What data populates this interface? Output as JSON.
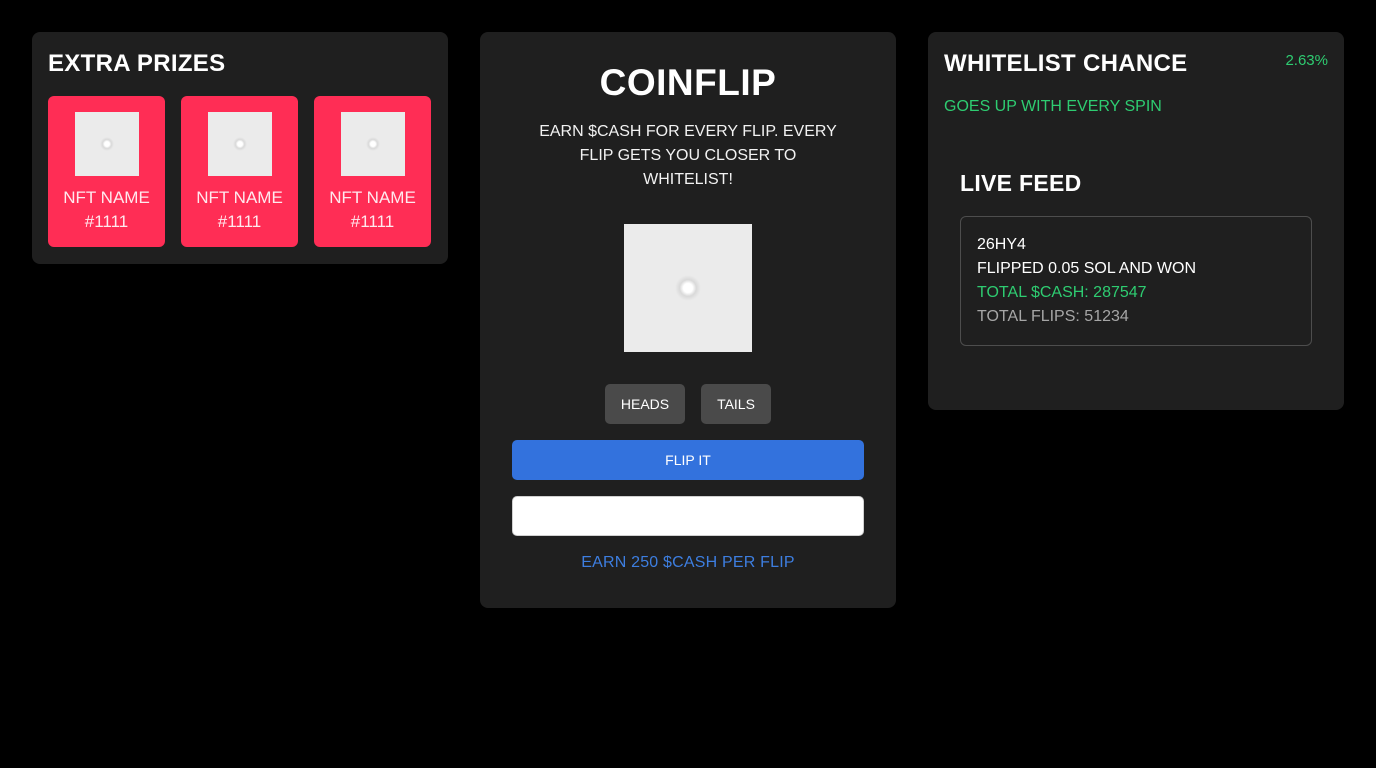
{
  "extra_prizes": {
    "title": "EXTRA PRIZES",
    "items": [
      {
        "name": "NFT NAME #1111"
      },
      {
        "name": "NFT NAME #1111"
      },
      {
        "name": "NFT NAME #1111"
      }
    ]
  },
  "coinflip": {
    "title": "COINFLIP",
    "description": "EARN $CASH FOR EVERY FLIP. EVERY FLIP GETS YOU CLOSER TO WHITELIST!",
    "heads_label": "HEADS",
    "tails_label": "TAILS",
    "flip_label": "FLIP IT",
    "amount_value": "",
    "earn_text": "EARN 250 $CASH PER FLIP"
  },
  "whitelist": {
    "title": "WHITELIST CHANCE",
    "percent": "2.63%",
    "subtitle": "GOES UP WITH EVERY SPIN"
  },
  "live_feed": {
    "title": "LIVE FEED",
    "entry": {
      "user": "26HY4",
      "action": "FLIPPED 0.05 SOL AND WON",
      "total_cash": "TOTAL $CASH: 287547",
      "total_flips": "TOTAL FLIPS: 51234"
    }
  },
  "colors": {
    "background": "#000000",
    "panel": "#1f1f1f",
    "prize_card": "#ff2d55",
    "accent_blue": "#3372dd",
    "accent_green": "#2ecc71"
  }
}
